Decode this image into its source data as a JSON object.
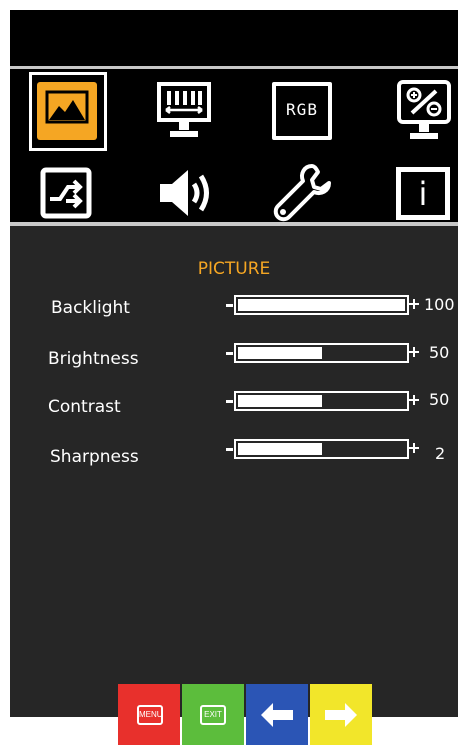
{
  "menu_title": "PICTURE",
  "icons": {
    "picture": "picture-icon",
    "display_size": "display-size-icon",
    "color": "rgb-color-icon",
    "rgb_text": "RGB",
    "adjust": "zoom-adjust-icon",
    "input": "input-source-icon",
    "audio": "speaker-icon",
    "settings": "wrench-icon",
    "info": "info-icon",
    "info_text": "i"
  },
  "settings": [
    {
      "label": "Backlight",
      "value": "100",
      "level": 1.0
    },
    {
      "label": "Brightness",
      "value": "50",
      "level": 0.5
    },
    {
      "label": "Contrast",
      "value": "50",
      "level": 0.5
    },
    {
      "label": "Sharpness",
      "value": "2",
      "level": 0.5
    }
  ],
  "buttons": {
    "menu_label": "MENU",
    "exit_label": "EXIT",
    "menu_color": "#e8302c",
    "exit_color": "#5cbd3c",
    "left_color": "#2b55b5",
    "right_color": "#f2e62a"
  },
  "colors": {
    "accent": "#f5a623",
    "panel": "#262626",
    "background": "#000000"
  }
}
